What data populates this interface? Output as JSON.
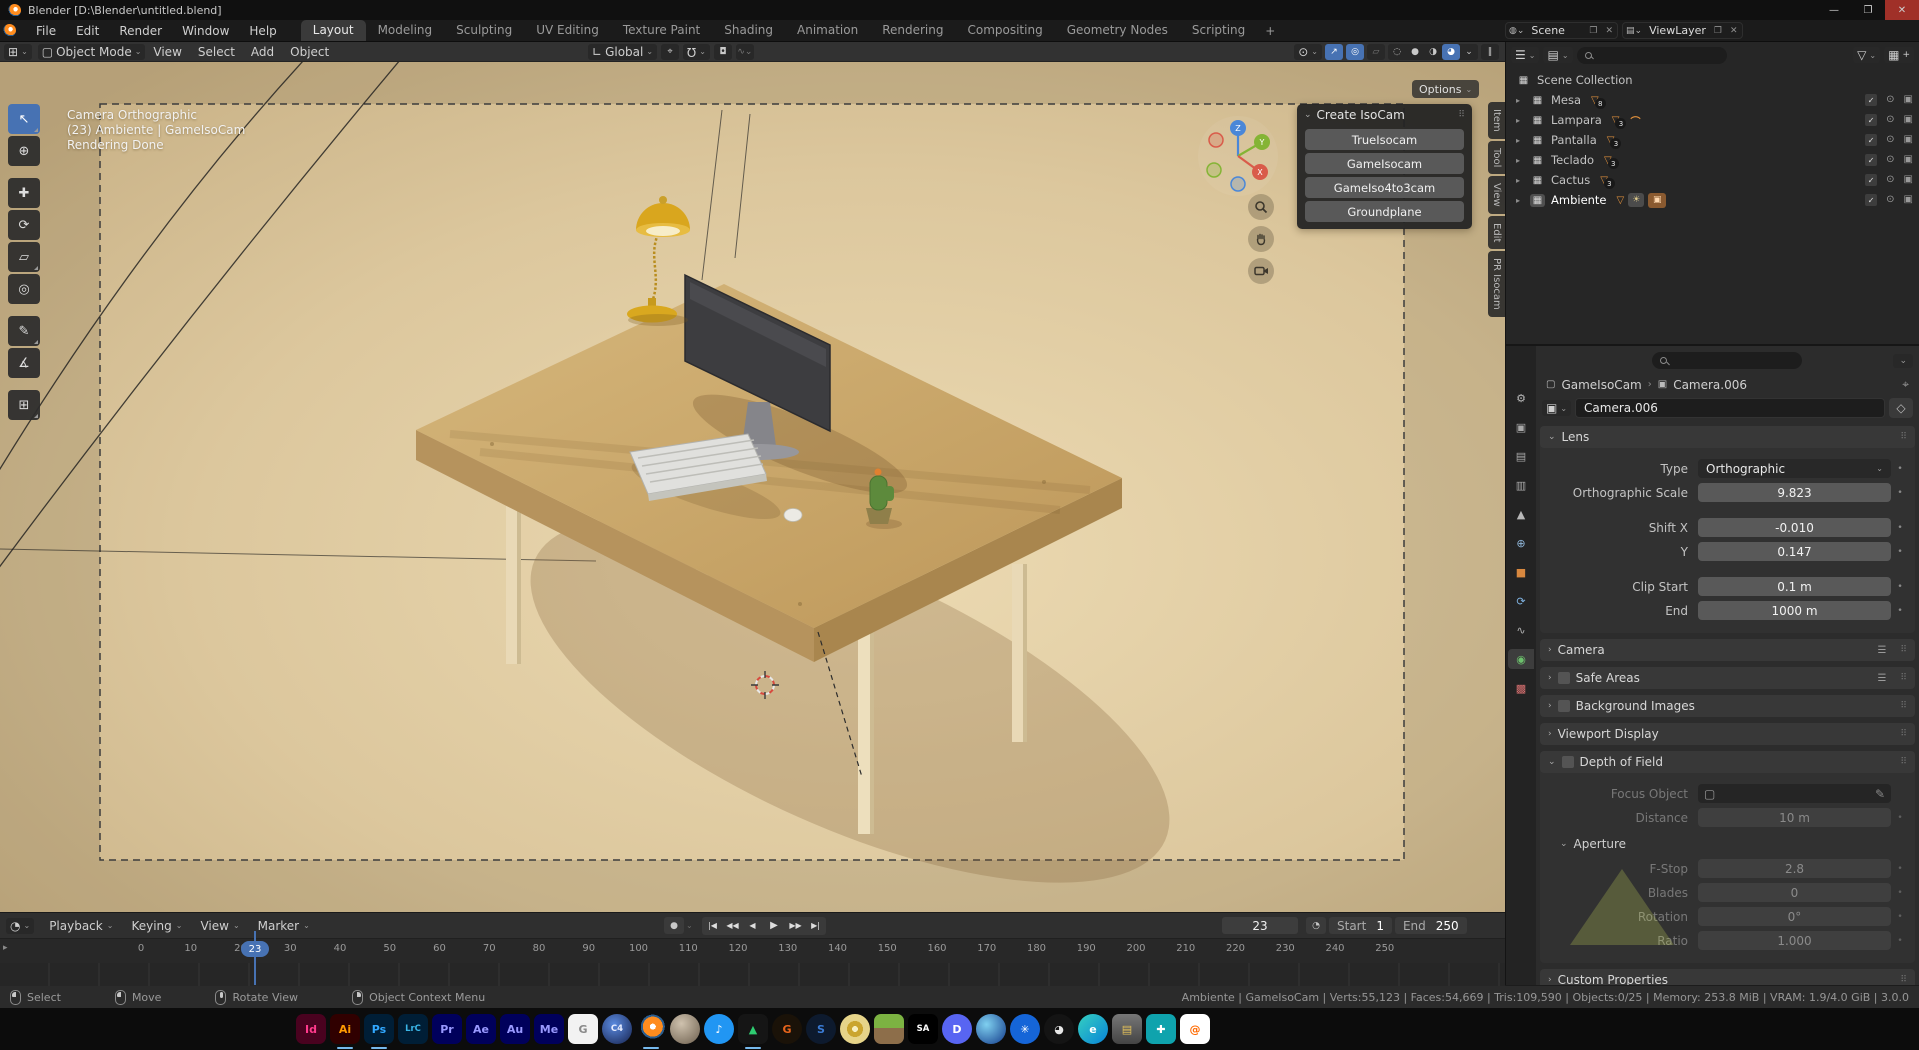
{
  "window": {
    "title": "Blender [D:\\Blender\\untitled.blend]",
    "minimize": "—",
    "maximize": "❐",
    "close": "✕"
  },
  "icons": {
    "chevron": "⌄",
    "chevron_r": "›",
    "expand": "▸",
    "dots": "⠿",
    "close": "✕",
    "copy": "❐",
    "pin": "⌖",
    "shield": "◇",
    "funnel": "▽",
    "collection": "▦",
    "mesh": "▽",
    "curve": "⌒",
    "bulb": "☀",
    "camera_chip": "▣",
    "check": "✓",
    "eye": "⊙",
    "camera_small": "▣",
    "menu_lines": "☰",
    "dot": "•",
    "record": "●",
    "clock": "◔",
    "magnet": "Ω",
    "prop_edit": "◘",
    "falloff": "∿",
    "pivot": "⌖",
    "orient": "∟",
    "mode_icon": "▢",
    "editor_3d": "⊞",
    "obj_icon": "▢",
    "cam_icon": "▣",
    "dropper": "✎",
    "plus": "+"
  },
  "menubar": [
    "File",
    "Edit",
    "Render",
    "Window",
    "Help"
  ],
  "workspaces": {
    "tabs": [
      {
        "label": "Layout",
        "active": true
      },
      {
        "label": "Modeling"
      },
      {
        "label": "Sculpting"
      },
      {
        "label": "UV Editing"
      },
      {
        "label": "Texture Paint"
      },
      {
        "label": "Shading"
      },
      {
        "label": "Animation"
      },
      {
        "label": "Rendering"
      },
      {
        "label": "Compositing"
      },
      {
        "label": "Geometry Nodes"
      },
      {
        "label": "Scripting"
      }
    ],
    "add": "+"
  },
  "topbar_right": {
    "scene": "Scene",
    "view_layer": "ViewLayer"
  },
  "viewport_header": {
    "mode": "Object Mode",
    "menus": [
      "View",
      "Select",
      "Add",
      "Object"
    ],
    "orientation": "Global",
    "icons": {
      "visibility": "⊙",
      "gizmo": "↗",
      "overlays": "◎",
      "xray": "▱",
      "shade_wire": "◌",
      "shade_solid": "●",
      "shade_material": "◑",
      "shade_rendered": "◕",
      "pause": "‖"
    }
  },
  "toolbar": {
    "tools": [
      {
        "name": "select-tweak",
        "glyph": "↖",
        "sub": true,
        "active": true
      },
      {
        "name": "cursor",
        "glyph": "⊕"
      },
      {
        "name": "move",
        "glyph": "✚"
      },
      {
        "name": "rotate",
        "glyph": "⟳"
      },
      {
        "name": "scale",
        "glyph": "▱",
        "sub": true
      },
      {
        "name": "transform",
        "glyph": "◎"
      },
      {
        "name": "annotate",
        "glyph": "✎",
        "sub": true
      },
      {
        "name": "measure",
        "glyph": "∡"
      },
      {
        "name": "add-cube",
        "glyph": "⊞",
        "sub": true
      }
    ]
  },
  "viewport": {
    "info": [
      "Camera Orthographic",
      "(23) Ambiente | GameIsoCam",
      "Rendering Done"
    ],
    "options": "Options",
    "axes": {
      "x": "X",
      "y": "Y",
      "z": "Z"
    },
    "axis_colors": {
      "x": "#d95b4a",
      "y": "#84b435",
      "z": "#4a87d8"
    }
  },
  "isocam": {
    "title": "Create IsoCam",
    "buttons": [
      "TrueIsocam",
      "GameIsocam",
      "GameIso4to3cam",
      "Groundplane"
    ]
  },
  "side_tabs": [
    "Item",
    "Tool",
    "View",
    "Edit",
    "PR Isocam"
  ],
  "outliner": {
    "root": "Scene Collection",
    "rows": [
      {
        "name": "Mesa",
        "count": "8"
      },
      {
        "name": "Lampara",
        "count": "3",
        "has_curve": true
      },
      {
        "name": "Pantalla",
        "count": "3"
      },
      {
        "name": "Teclado",
        "count": "3"
      },
      {
        "name": "Cactus",
        "count": "3"
      },
      {
        "name": "Ambiente",
        "count": "",
        "is_ambient": true,
        "selected": true
      }
    ]
  },
  "prop_tabs": [
    {
      "name": "tool",
      "glyph": "⚙",
      "color": "#b8b8b8"
    },
    {
      "name": "render",
      "glyph": "▣",
      "color": "#a8a8a8"
    },
    {
      "name": "output",
      "glyph": "▤",
      "color": "#a8a8a8"
    },
    {
      "name": "view-layer",
      "glyph": "▥",
      "color": "#a8a8a8"
    },
    {
      "name": "scene",
      "glyph": "▲",
      "color": "#b8b8b8"
    },
    {
      "name": "world",
      "glyph": "⊕",
      "color": "#8fb5d8"
    },
    {
      "name": "object",
      "glyph": "■",
      "color": "#d8883f"
    },
    {
      "name": "physics",
      "glyph": "⟳",
      "color": "#7fb2e0"
    },
    {
      "name": "constraints",
      "glyph": "∿",
      "color": "#b0b0b0"
    },
    {
      "name": "object-data",
      "glyph": "◉",
      "color": "#6cc06c",
      "active": true
    },
    {
      "name": "texture",
      "glyph": "▩",
      "color": "#d87070"
    }
  ],
  "properties": {
    "breadcrumb": {
      "object": "GameIsoCam",
      "data": "Camera.006"
    },
    "name_value": "Camera.006",
    "lens": {
      "title": "Lens",
      "type_label": "Type",
      "type_value": "Orthographic",
      "scale_label": "Orthographic Scale",
      "scale_value": "9.823",
      "shift_x_label": "Shift X",
      "shift_x": "-0.010",
      "shift_y_label": "Y",
      "shift_y": "0.147",
      "clip_start_label": "Clip Start",
      "clip_start": "0.1 m",
      "clip_end_label": "End",
      "clip_end": "1000 m"
    },
    "section_camera": "Camera",
    "section_safe_areas": "Safe Areas",
    "section_background": "Background Images",
    "section_viewport_display": "Viewport Display",
    "dof": {
      "title": "Depth of Field",
      "focus_label": "Focus Object",
      "distance_label": "Distance",
      "distance": "10 m",
      "aperture": "Aperture",
      "fstop_label": "F-Stop",
      "fstop": "2.8",
      "blades_label": "Blades",
      "blades": "0",
      "rotation_label": "Rotation",
      "rotation": "0°",
      "ratio_label": "Ratio",
      "ratio": "1.000"
    },
    "section_custom": "Custom Properties"
  },
  "timeline": {
    "menus": [
      {
        "label": "Playback",
        "drop": true
      },
      {
        "label": "Keying",
        "drop": true
      },
      {
        "label": "View"
      },
      {
        "label": "Marker"
      }
    ],
    "transport": [
      {
        "name": "jump-start",
        "glyph": "|◀"
      },
      {
        "name": "prev-keyframe",
        "glyph": "◀◀"
      },
      {
        "name": "prev-frame",
        "glyph": "◀"
      },
      {
        "name": "play",
        "glyph": "▶",
        "play": true
      },
      {
        "name": "next-keyframe",
        "glyph": "▶▶"
      },
      {
        "name": "jump-end",
        "glyph": "▶|"
      }
    ],
    "current": "23",
    "start_label": "Start",
    "start": "1",
    "end_label": "End",
    "end": "250",
    "ticks": [
      "0",
      "10",
      "20",
      "30",
      "40",
      "50",
      "60",
      "70",
      "80",
      "90",
      "100",
      "110",
      "120",
      "130",
      "140",
      "150",
      "160",
      "170",
      "180",
      "190",
      "200",
      "210",
      "220",
      "230",
      "240",
      "250"
    ]
  },
  "statusbar": {
    "hints": [
      {
        "label": "Select",
        "btn": "mouse-left"
      },
      {
        "label": "Move",
        "btn": "mouse-left"
      },
      {
        "label": "Rotate View",
        "btn": "mouse-middle"
      },
      {
        "label": "Object Context Menu",
        "btn": "mouse-right"
      }
    ],
    "stats": "Ambiente | GameIsoCam | Verts:55,123 | Faces:54,669 | Tris:109,590 | Objects:0/25 | Memory: 253.8 MiB | VRAM: 1.9/4.0 GiB | 3.0.0"
  },
  "taskbar": {
    "icons": [
      {
        "name": "indesign",
        "label": "Id",
        "bg": "#49021f",
        "fg": "#ff3a8c"
      },
      {
        "name": "illustrator",
        "label": "Ai",
        "bg": "#300000",
        "fg": "#ff9a00",
        "running": true
      },
      {
        "name": "photoshop",
        "label": "Ps",
        "bg": "#001e36",
        "fg": "#31a8ff",
        "running": true
      },
      {
        "name": "lightroom-classic",
        "label": "LrC",
        "bg": "#001e36",
        "fg": "#3ab5e6",
        "small": true
      },
      {
        "name": "premiere-pro",
        "label": "Pr",
        "bg": "#00005b",
        "fg": "#9999ff"
      },
      {
        "name": "after-effects",
        "label": "Ae",
        "bg": "#00005b",
        "fg": "#9999ff"
      },
      {
        "name": "audition",
        "label": "Au",
        "bg": "#00005b",
        "fg": "#9999ff"
      },
      {
        "name": "media-encoder",
        "label": "Me",
        "bg": "#00005b",
        "fg": "#9999ff"
      },
      {
        "name": "gravit-designer",
        "label": "G",
        "bg": "#f2f2f2",
        "fg": "#8a8a8a"
      },
      {
        "name": "cinema-4d",
        "label": "C4",
        "bg": "radial-gradient(circle at 40% 35%, #5a8ae0, #16224d)",
        "fg": "#e6ecff",
        "circle": true,
        "small": true
      },
      {
        "name": "blender",
        "label": "",
        "bg": "radial-gradient(circle at 56% 42%, #ffffff 0 3px, #ff8c1e 3px 10px, #2a5d8f 10px 12px, #0c0c0c 12px)",
        "fg": "#fff",
        "circle": true,
        "running": true
      },
      {
        "name": "sphere-app",
        "label": "",
        "bg": "radial-gradient(circle at 38% 32%, #cfc2ae, #6d5f4e)",
        "fg": "#fff",
        "circle": true
      },
      {
        "name": "volume-app",
        "label": "♪",
        "bg": "#2196f3",
        "fg": "#ffffff",
        "circle": true
      },
      {
        "name": "triangles-app",
        "label": "▲",
        "bg": "#151515",
        "fg": "#2ecc71",
        "running": true
      },
      {
        "name": "gigapixel",
        "label": "G",
        "bg": "#1a1208",
        "fg": "#e8641b",
        "circle": true
      },
      {
        "name": "sharpen",
        "label": "S",
        "bg": "#0d1a2e",
        "fg": "#3a7bd5",
        "circle": true
      },
      {
        "name": "disc-burner",
        "label": "",
        "bg": "radial-gradient(circle, #f7efc0 0 3px, #caa52f 3px 8px, #e6d489 8px 13px)",
        "fg": "#fff",
        "circle": true
      },
      {
        "name": "minecraft",
        "label": "",
        "bg": "linear-gradient(#7cb342 0 46%, #8d6e4a 46%)",
        "fg": "#fff"
      },
      {
        "name": "gta-sa",
        "label": "SA",
        "bg": "#000000",
        "fg": "#ffffff",
        "small": true
      },
      {
        "name": "discord",
        "label": "D",
        "bg": "#5865f2",
        "fg": "#ffffff",
        "circle": true
      },
      {
        "name": "browser-sphere",
        "label": "",
        "bg": "radial-gradient(circle at 35% 35%, #7fd0f0, #123a8a)",
        "fg": "#fff",
        "circle": true
      },
      {
        "name": "atom-app",
        "label": "✳",
        "bg": "#1565d8",
        "fg": "#ffffff",
        "circle": true
      },
      {
        "name": "obs-studio",
        "label": "◕",
        "bg": "#141414",
        "fg": "#e8e8e8",
        "circle": true
      },
      {
        "name": "edge",
        "label": "e",
        "bg": "linear-gradient(135deg, #35d0c0, #0883d8)",
        "fg": "#ffffff",
        "circle": true
      },
      {
        "name": "recovery-app",
        "label": "▤",
        "bg": "linear-gradient(#777, #444)",
        "fg": "#e6c35a"
      },
      {
        "name": "first-aid-app",
        "label": "✚",
        "bg": "#0fa3ad",
        "fg": "#ffffff"
      },
      {
        "name": "swirl-app",
        "label": "@",
        "bg": "#ffffff",
        "fg": "#ff6a00"
      }
    ]
  }
}
